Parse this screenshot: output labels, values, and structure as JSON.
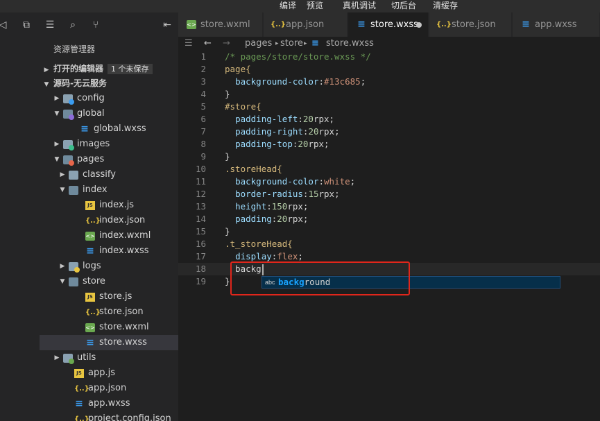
{
  "menu": [
    "编译",
    "预览",
    "真机调试",
    "切后台",
    "清缓存"
  ],
  "explorer": {
    "title": "资源管理器",
    "open_editors": {
      "label": "打开的编辑器",
      "badge": "1 个未保存"
    },
    "project": {
      "label": "源码-无云服务"
    },
    "tree": [
      {
        "label": "config",
        "icon": "folder-gear-icon",
        "kind": "folder",
        "expanded": false
      },
      {
        "label": "global",
        "icon": "folder-globe-icon",
        "kind": "folder",
        "expanded": true
      },
      {
        "label": "global.wxss",
        "icon": "wxss-file-icon",
        "kind": "wxss"
      },
      {
        "label": "images",
        "icon": "folder-images-icon",
        "kind": "folder",
        "expanded": false
      },
      {
        "label": "pages",
        "icon": "folder-pages-icon",
        "kind": "folder",
        "expanded": true
      },
      {
        "label": "classify",
        "icon": "folder-icon",
        "kind": "folder",
        "expanded": false
      },
      {
        "label": "index",
        "icon": "folder-open-icon",
        "kind": "folder",
        "expanded": true
      },
      {
        "label": "index.js",
        "icon": "js-file-icon",
        "kind": "js"
      },
      {
        "label": "index.json",
        "icon": "json-file-icon",
        "kind": "json"
      },
      {
        "label": "index.wxml",
        "icon": "wxml-file-icon",
        "kind": "wxml"
      },
      {
        "label": "index.wxss",
        "icon": "wxss-file-icon",
        "kind": "wxss"
      },
      {
        "label": "logs",
        "icon": "folder-logs-icon",
        "kind": "folder",
        "expanded": false
      },
      {
        "label": "store",
        "icon": "folder-open-icon",
        "kind": "folder",
        "expanded": true
      },
      {
        "label": "store.js",
        "icon": "js-file-icon",
        "kind": "js"
      },
      {
        "label": "store.json",
        "icon": "json-file-icon",
        "kind": "json"
      },
      {
        "label": "store.wxml",
        "icon": "wxml-file-icon",
        "kind": "wxml"
      },
      {
        "label": "store.wxss",
        "icon": "wxss-file-icon",
        "kind": "wxss",
        "selected": true
      },
      {
        "label": "utils",
        "icon": "folder-utils-icon",
        "kind": "folder",
        "expanded": false
      },
      {
        "label": "app.js",
        "icon": "js-file-icon",
        "kind": "js"
      },
      {
        "label": "app.json",
        "icon": "json-file-icon",
        "kind": "json"
      },
      {
        "label": "app.wxss",
        "icon": "wxss-file-icon",
        "kind": "wxss"
      },
      {
        "label": "project.config.json",
        "icon": "json-file-icon",
        "kind": "json"
      }
    ]
  },
  "tabs": [
    {
      "label": "store.wxml",
      "icon": "wxml-file-icon",
      "active": false
    },
    {
      "label": "app.json",
      "icon": "json-file-icon",
      "active": false
    },
    {
      "label": "store.wxss",
      "icon": "wxss-file-icon",
      "active": true,
      "modified": true
    },
    {
      "label": "store.json",
      "icon": "json-file-icon",
      "active": false
    },
    {
      "label": "app.wxss",
      "icon": "wxss-file-icon",
      "active": false
    }
  ],
  "breadcrumb": [
    "pages",
    "store",
    "store.wxss"
  ],
  "code_lines": [
    {
      "n": "1",
      "tokens": [
        [
          "comment",
          "/* pages/store/store.wxss */"
        ]
      ]
    },
    {
      "n": "2",
      "tokens": [
        [
          "plain",
          "page{"
        ]
      ]
    },
    {
      "n": "3",
      "tokens": [
        [
          "plain",
          "  "
        ],
        [
          "prop",
          "background-color"
        ],
        [
          "punc",
          ":"
        ],
        [
          "val",
          "#13c685"
        ],
        [
          "punc",
          ";"
        ]
      ]
    },
    {
      "n": "4",
      "tokens": [
        [
          "plain",
          "}"
        ]
      ]
    },
    {
      "n": "5",
      "tokens": [
        [
          "plain",
          "#store{"
        ]
      ]
    },
    {
      "n": "6",
      "tokens": [
        [
          "plain",
          "  "
        ],
        [
          "prop",
          "padding-left"
        ],
        [
          "punc",
          ":"
        ],
        [
          "num",
          "20"
        ],
        [
          "unit",
          "rpx"
        ],
        [
          "punc",
          ";"
        ]
      ]
    },
    {
      "n": "7",
      "tokens": [
        [
          "plain",
          "  "
        ],
        [
          "prop",
          "padding-right"
        ],
        [
          "punc",
          ":"
        ],
        [
          "num",
          "20"
        ],
        [
          "unit",
          "rpx"
        ],
        [
          "punc",
          ";"
        ]
      ]
    },
    {
      "n": "8",
      "tokens": [
        [
          "plain",
          "  "
        ],
        [
          "prop",
          "padding-top"
        ],
        [
          "punc",
          ":"
        ],
        [
          "num",
          "20"
        ],
        [
          "unit",
          "rpx"
        ],
        [
          "punc",
          ";"
        ]
      ]
    },
    {
      "n": "9",
      "tokens": [
        [
          "plain",
          "}"
        ]
      ]
    },
    {
      "n": "10",
      "tokens": [
        [
          "plain",
          ".storeHead{"
        ]
      ]
    },
    {
      "n": "11",
      "tokens": [
        [
          "plain",
          "  "
        ],
        [
          "prop",
          "background-color"
        ],
        [
          "punc",
          ":"
        ],
        [
          "val",
          "white"
        ],
        [
          "punc",
          ";"
        ]
      ]
    },
    {
      "n": "12",
      "tokens": [
        [
          "plain",
          "  "
        ],
        [
          "prop",
          "border-radius"
        ],
        [
          "punc",
          ":"
        ],
        [
          "num",
          "15"
        ],
        [
          "unit",
          "rpx"
        ],
        [
          "punc",
          ";"
        ]
      ]
    },
    {
      "n": "13",
      "tokens": [
        [
          "plain",
          "  "
        ],
        [
          "prop",
          "height"
        ],
        [
          "punc",
          ":"
        ],
        [
          "num",
          "150"
        ],
        [
          "unit",
          "rpx"
        ],
        [
          "punc",
          ";"
        ]
      ]
    },
    {
      "n": "14",
      "tokens": [
        [
          "plain",
          "  "
        ],
        [
          "prop",
          "padding"
        ],
        [
          "punc",
          ":"
        ],
        [
          "num",
          "20"
        ],
        [
          "unit",
          "rpx"
        ],
        [
          "punc",
          ";"
        ]
      ]
    },
    {
      "n": "15",
      "tokens": [
        [
          "plain",
          "}"
        ]
      ]
    },
    {
      "n": "16",
      "tokens": [
        [
          "plain",
          ".t_storeHead{"
        ]
      ]
    },
    {
      "n": "17",
      "tokens": [
        [
          "plain",
          "  "
        ],
        [
          "prop",
          "display"
        ],
        [
          "punc",
          ":"
        ],
        [
          "val",
          "flex"
        ],
        [
          "punc",
          ";"
        ]
      ]
    },
    {
      "n": "18",
      "tokens": [
        [
          "plain",
          "  backg"
        ]
      ],
      "current": true
    },
    {
      "n": "19",
      "tokens": [
        [
          "plain",
          "}"
        ]
      ]
    }
  ],
  "suggestion": {
    "kind": "abc",
    "match": "backg",
    "rest": "round"
  },
  "colors": {
    "wxss": "#3b9df1",
    "json": "#e8c540",
    "js": "#e8c540",
    "wxml": "#6aa84f",
    "highlight_box": "#e0261b"
  }
}
